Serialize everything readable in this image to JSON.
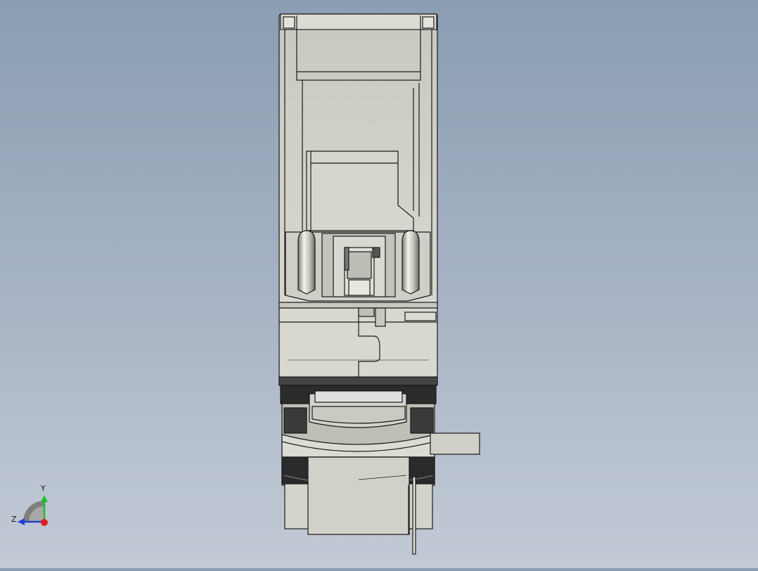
{
  "view": {
    "background_top": "#8a9db2",
    "background_bottom": "#c3cad6",
    "part_fill": "#d3d3cb",
    "part_fill_light": "#e2e2da",
    "part_shadow": "#9c9c94",
    "edge_color": "#1a1a1a"
  },
  "triad": {
    "y_label": "Y",
    "z_label": "Z",
    "y_color": "#1fbf2a",
    "z_color": "#1f3fd0",
    "x_color": "#e02020"
  }
}
